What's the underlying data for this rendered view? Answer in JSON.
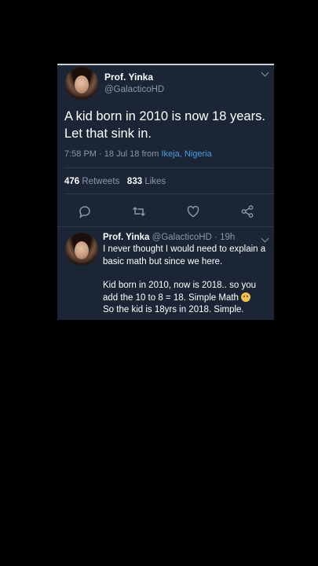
{
  "tweet": {
    "author_name": "Prof. Yinka",
    "author_handle": "@GalacticoHD",
    "text": "A kid born in 2010 is now 18 years. Let that sink in.",
    "meta_time": "7:58 PM · 18 Jul 18 from ",
    "meta_location": "Ikeja, Nigeria",
    "retweets_count": "476",
    "retweets_label": "Retweets",
    "likes_count": "833",
    "likes_label": "Likes"
  },
  "reply": {
    "author_name": "Prof. Yinka",
    "handle_and_time": "@GalacticoHD · 19h",
    "paragraph1": "I never thought I would need to explain a basic math but since we here.",
    "paragraph2_line1": "Kid born in 2010, now is 2018.. so you add the 10 to 8 = 18. Simple Math",
    "paragraph2_line2": "So the kid is 18yrs in 2018. Simple."
  },
  "icons": [
    "chevron-down-icon",
    "reply-icon",
    "retweet-icon",
    "like-icon",
    "share-icon",
    "emoji-icon"
  ],
  "colors": {
    "page_background": "#000000",
    "card_background": "#1b2535",
    "secondary_text": "#8899a6",
    "link": "#4a9fe8"
  }
}
